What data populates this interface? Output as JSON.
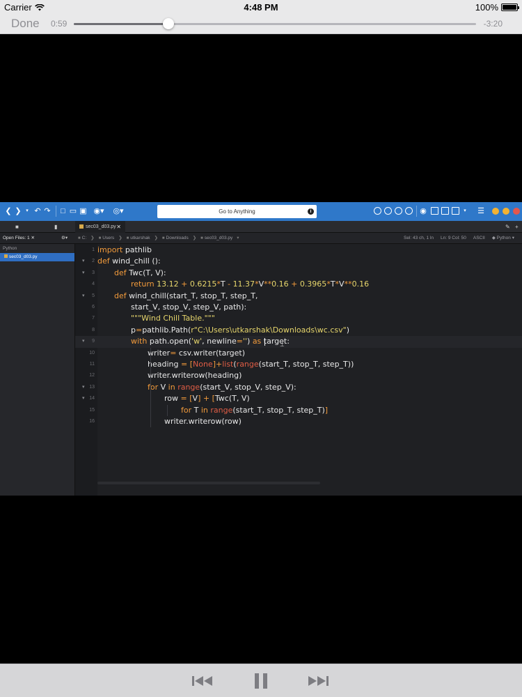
{
  "status_bar": {
    "carrier": "Carrier",
    "time": "4:48 PM",
    "battery": "100%"
  },
  "player": {
    "done_label": "Done",
    "elapsed": "0:59",
    "remaining": "-3:20",
    "progress_fraction": 0.235
  },
  "ide": {
    "goto_placeholder": "Go to Anything",
    "open_tab": "sec03_d03.py",
    "open_files_label": "Open Files: 1",
    "breadcrumbs": [
      "C:",
      "Users",
      "utkarshak",
      "Downloads",
      "sec03_d03.py"
    ],
    "status": {
      "selection": "Sel: 43 ch, 1 ln",
      "position": "Ln: 9 Col: 50",
      "encoding": "ASCII",
      "language": "Python"
    },
    "sidebar_group": "Python",
    "sidebar_file": "sec03_d03.py",
    "accent_color": "#2f78c9",
    "code_lines": [
      {
        "n": "1",
        "text": "import pathlib"
      },
      {
        "n": "2",
        "text": "def wind_chill ():"
      },
      {
        "n": "3",
        "text": "def Twc(T, V):"
      },
      {
        "n": "4",
        "text": "return 13.12 + 0.6215*T - 11.37*V**0.16 + 0.3965*T*V**0.16"
      },
      {
        "n": "5",
        "text": "def wind_chill(start_T, stop_T, step_T,"
      },
      {
        "n": "6",
        "text": "start_V, stop_V, step_V, path):"
      },
      {
        "n": "7",
        "text": "\"\"\"Wind Chill Table.\"\"\""
      },
      {
        "n": "8",
        "text": "p=pathlib.Path(r\"C:\\Users\\utkarshak\\Downloads\\wc.csv\")"
      },
      {
        "n": "9",
        "text": "with path.open('w', newline='') as target:"
      },
      {
        "n": "10",
        "text": "writer= csv.writer(target)"
      },
      {
        "n": "11",
        "text": "heading = [None]+list(range(start_T, stop_T, step_T))"
      },
      {
        "n": "12",
        "text": "writer.writerow(heading)"
      },
      {
        "n": "13",
        "text": "for V in range(start_V, stop_V, step_V):"
      },
      {
        "n": "14",
        "text": "row = [V] + [Twc(T, V)"
      },
      {
        "n": "15",
        "text": "for T in range(start_T, stop_T, step_T)]"
      },
      {
        "n": "16",
        "text": "writer.writerow(row)"
      }
    ]
  }
}
